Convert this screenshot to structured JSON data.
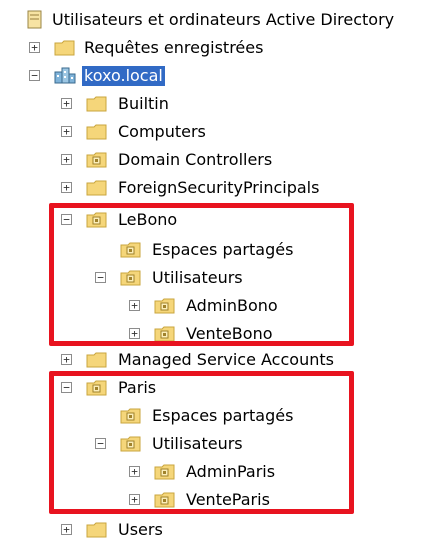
{
  "tree": {
    "root": {
      "label": "Utilisateurs et ordinateurs Active Directory",
      "icon": "ad-console-icon"
    },
    "saved_queries": {
      "label": "Requêtes enregistrées",
      "expander": "+",
      "icon": "folder-icon"
    },
    "domain": {
      "label": "koxo.local",
      "expander": "−",
      "icon": "domain-icon",
      "selected": true
    },
    "builtin": {
      "label": "Builtin",
      "expander": "+",
      "icon": "folder-icon"
    },
    "computers": {
      "label": "Computers",
      "expander": "+",
      "icon": "folder-icon"
    },
    "domain_controllers": {
      "label": "Domain Controllers",
      "expander": "+",
      "icon": "ou-icon"
    },
    "fsp": {
      "label": "ForeignSecurityPrincipals",
      "expander": "+",
      "icon": "folder-icon"
    },
    "lebono": {
      "label": "LeBono",
      "expander": "−",
      "icon": "ou-icon",
      "shared": {
        "label": "Espaces partagés",
        "icon": "ou-icon"
      },
      "users": {
        "label": "Utilisateurs",
        "expander": "−",
        "icon": "ou-icon",
        "admin": {
          "label": "AdminBono",
          "expander": "+",
          "icon": "ou-icon"
        },
        "vente": {
          "label": "VenteBono",
          "expander": "+",
          "icon": "ou-icon"
        }
      }
    },
    "msa": {
      "label": "Managed Service Accounts",
      "expander": "+",
      "icon": "folder-icon"
    },
    "paris": {
      "label": "Paris",
      "expander": "−",
      "icon": "ou-icon",
      "shared": {
        "label": "Espaces partagés",
        "icon": "ou-icon"
      },
      "users": {
        "label": "Utilisateurs",
        "expander": "−",
        "icon": "ou-icon",
        "admin": {
          "label": "AdminParis",
          "expander": "+",
          "icon": "ou-icon"
        },
        "vente": {
          "label": "VenteParis",
          "expander": "+",
          "icon": "ou-icon"
        }
      }
    },
    "users": {
      "label": "Users",
      "expander": "+",
      "icon": "folder-icon"
    }
  },
  "colors": {
    "highlight_border": "#e8131f",
    "selection": "#316ac5",
    "folder": "#f5d67a",
    "folder_edge": "#c9a53e"
  }
}
